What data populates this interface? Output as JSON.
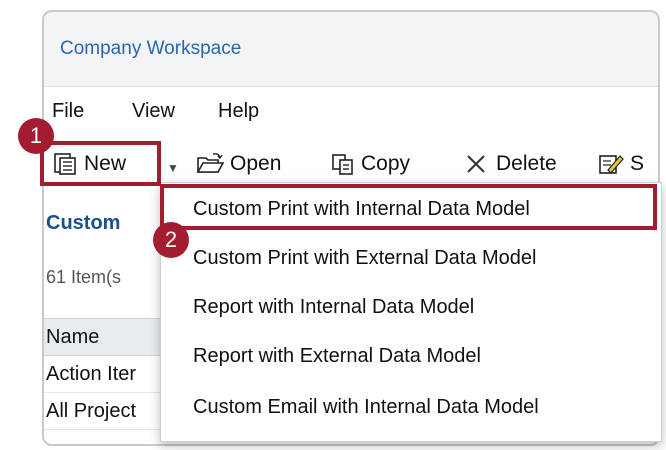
{
  "window": {
    "title": "Company Workspace"
  },
  "menubar": {
    "items": [
      "File",
      "View",
      "Help"
    ]
  },
  "toolbar": {
    "new_label": "New",
    "open_label": "Open",
    "copy_label": "Copy",
    "delete_label": "Delete",
    "truncated_label": "S"
  },
  "panel": {
    "section_title": "Custom",
    "item_count": "61  Item(s",
    "table_header": "Name",
    "rows": [
      "Action Iter",
      "All Project"
    ]
  },
  "new_dropdown": {
    "items": [
      "Custom Print with Internal Data Model",
      "Custom Print with External Data Model",
      "Report with Internal Data Model",
      "Report with External Data Model",
      "Custom Email with Internal Data Model"
    ]
  },
  "callouts": {
    "step1": "1",
    "step2": "2"
  },
  "colors": {
    "accent_red": "#a41c30",
    "title_blue": "#2a67b1"
  },
  "icons": [
    "new-icon",
    "open-folder-icon",
    "copy-icon",
    "delete-x-icon",
    "edit-icon",
    "dropdown-caret-icon"
  ]
}
